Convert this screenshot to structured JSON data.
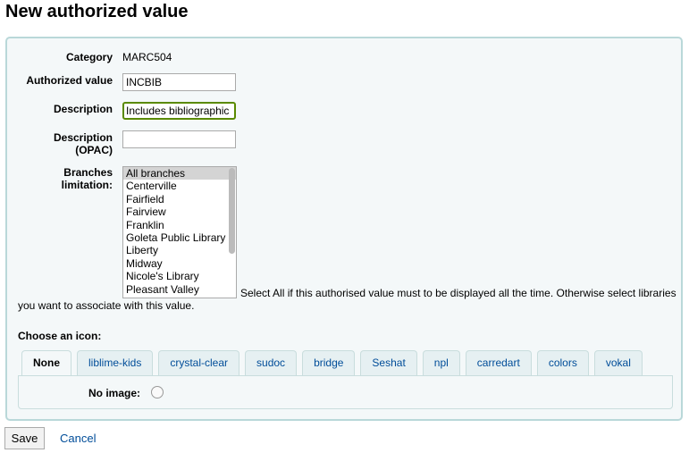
{
  "title": "New authorized value",
  "form": {
    "category_label": "Category",
    "category_value": "MARC504",
    "authval_label": "Authorized value",
    "authval_value": "INCBIB",
    "desc_label": "Description",
    "desc_value": "Includes bibliographic re",
    "desc_opac_label1": "Description",
    "desc_opac_label2": "(OPAC)",
    "desc_opac_value": "",
    "branches_label1": "Branches",
    "branches_label2": "limitation:",
    "branches": [
      "All branches",
      "Centerville",
      "Fairfield",
      "Fairview",
      "Franklin",
      "Goleta Public Library",
      "Liberty",
      "Midway",
      "Nicole's Library",
      "Pleasant Valley"
    ],
    "branches_selected": "All branches",
    "branches_hint": "Select All if this authorised value must to be displayed all the time. Otherwise select libraries you want to associate with this value.",
    "icon_label": "Choose an icon:",
    "tabs": [
      "None",
      "liblime-kids",
      "crystal-clear",
      "sudoc",
      "bridge",
      "Seshat",
      "npl",
      "carredart",
      "colors",
      "vokal"
    ],
    "active_tab": "None",
    "no_image_label": "No image:"
  },
  "actions": {
    "save": "Save",
    "cancel": "Cancel"
  },
  "colors": {
    "accent": "#004d99",
    "fieldset_border": "#b9d8d9",
    "focus": "#5a8a00"
  }
}
